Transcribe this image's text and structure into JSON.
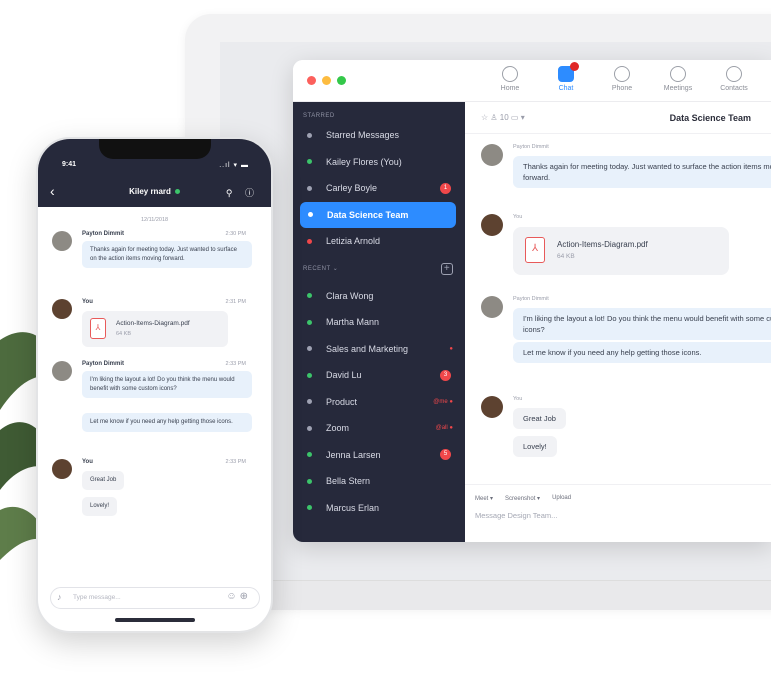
{
  "desktop": {
    "nav": [
      "Home",
      "Chat",
      "Phone",
      "Meetings",
      "Contacts"
    ],
    "starred_label": "STARRED",
    "recent_label": "RECENT",
    "starred": [
      {
        "label": "Starred Messages",
        "color": "#9ea1b2"
      },
      {
        "label": "Kailey Flores (You)",
        "color": "#3cc46a"
      },
      {
        "label": "Carley Boyle",
        "color": "#9ea1b2",
        "count": "1"
      },
      {
        "label": "Data Science Team",
        "color": "#ffffff",
        "active": true
      },
      {
        "label": "Letizia Arnold",
        "color": "#f0474a"
      }
    ],
    "recent": [
      {
        "label": "Clara Wong",
        "color": "#3cc46a"
      },
      {
        "label": "Martha Mann",
        "color": "#3cc46a"
      },
      {
        "label": "Sales and Marketing",
        "color": "#9ea1b2",
        "tag": "●"
      },
      {
        "label": "David Lu",
        "color": "#3cc46a",
        "count": "3"
      },
      {
        "label": "Product",
        "color": "#9ea1b2",
        "tag": "@me ●"
      },
      {
        "label": "Zoom",
        "color": "#9ea1b2",
        "tag": "@all ●"
      },
      {
        "label": "Jenna Larsen",
        "color": "#3cc46a",
        "count": "5"
      },
      {
        "label": "Bella Stern",
        "color": "#3cc46a"
      },
      {
        "label": "Marcus Erlan",
        "color": "#3cc46a"
      }
    ],
    "header_tools": "☆  ♙ 10   ▭ ▾",
    "channel_title": "Data Science Team",
    "messages": {
      "m1_name": "Payton Dimmit",
      "m1_text": "Thanks again for meeting today. Just wanted to surface the action items moving forward.",
      "m2_name": "You",
      "file_name": "Action-Items-Diagram.pdf",
      "file_size": "64 KB",
      "m3_name": "Payton Dimmit",
      "m3_text1": "I'm liking the layout a lot! Do you think the menu would benefit with some custom icons?",
      "m3_text2": "Let me know if you need any help getting those icons.",
      "m4_name": "You",
      "m4_text1": "Great Job",
      "m4_text2": "Lovely!"
    },
    "composer": {
      "tools": [
        "Meet ▾",
        "Screenshot ▾",
        "Upload"
      ],
      "placeholder": "Message Design Team..."
    }
  },
  "phone": {
    "time": "9:41",
    "signal": "..ıl ▾ ▬",
    "title": "Kiley rnard",
    "date": "12/11/2018",
    "m1_name": "Payton Dimmit",
    "m1_time": "2:30 PM",
    "m1_text": "Thanks again for meeting today. Just wanted to surface on the action items moving forward.",
    "m2_name": "You",
    "m2_time": "2:31 PM",
    "file_name": "Action-Items-Diagram.pdf",
    "file_size": "64 KB",
    "m3_name": "Payton Dimmit",
    "m3_time": "2:33 PM",
    "m3_text1": "I'm liking the layout a lot! Do you think the menu would benefit with some custom icons?",
    "m3_text2": "Let me know if you need any help getting those icons.",
    "m4_name": "You",
    "m4_time": "2:33 PM",
    "m4_text1": "Great Job",
    "m4_text2": "Lovely!",
    "input_placeholder": "Type message..."
  }
}
